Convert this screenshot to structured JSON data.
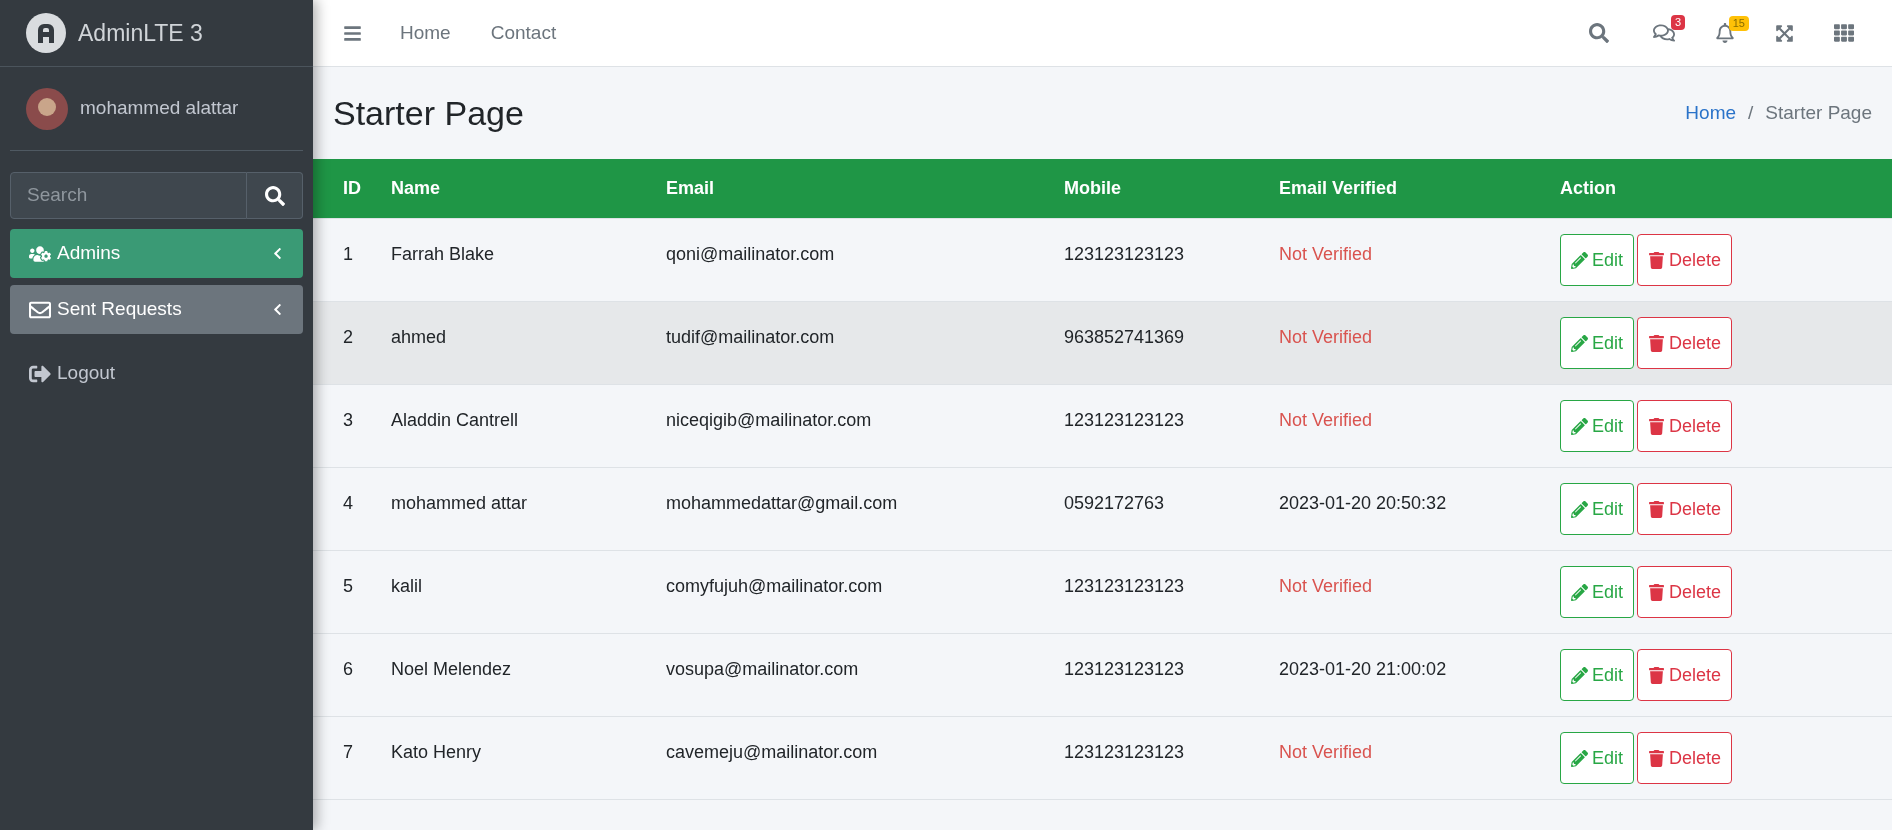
{
  "brand": {
    "title": "AdminLTE 3"
  },
  "user": {
    "name": "mohammed alattar"
  },
  "sidebar": {
    "search": {
      "placeholder": "Search"
    },
    "items": [
      {
        "label": "Admins",
        "kind": "users",
        "selected": true,
        "expandable": true
      },
      {
        "label": "Sent Requests",
        "kind": "envelope",
        "selected": false,
        "expandable": true
      },
      {
        "label": "Logout",
        "kind": "logout",
        "selected": false,
        "expandable": false
      }
    ]
  },
  "navbar": {
    "links": [
      "Home",
      "Contact"
    ],
    "messages_badge": "3",
    "notifications_badge": "15"
  },
  "page": {
    "title": "Starter Page",
    "breadcrumb_separator": "/",
    "breadcrumb": [
      {
        "label": "Home",
        "link": true
      },
      {
        "label": "Starter Page",
        "link": false
      }
    ]
  },
  "table": {
    "columns": [
      "ID",
      "Name",
      "Email",
      "Mobile",
      "Email Verified",
      "Action"
    ],
    "rows": [
      {
        "id": "1",
        "name": "Farrah Blake",
        "email": "qoni@mailinator.com",
        "mobile": "123123123123",
        "verified": "Not Verified",
        "is_verified": false,
        "highlighted": false,
        "actions": [
          "Edit",
          "Delete"
        ]
      },
      {
        "id": "2",
        "name": "ahmed",
        "email": "tudif@mailinator.com",
        "mobile": "963852741369",
        "verified": "Not Verified",
        "is_verified": false,
        "highlighted": true,
        "actions": [
          "Edit",
          "Delete"
        ]
      },
      {
        "id": "3",
        "name": "Aladdin Cantrell",
        "email": "niceqigib@mailinator.com",
        "mobile": "123123123123",
        "verified": "Not Verified",
        "is_verified": false,
        "highlighted": false,
        "actions": [
          "Edit",
          "Delete"
        ]
      },
      {
        "id": "4",
        "name": "mohammed attar",
        "email": "mohammedattar@gmail.com",
        "mobile": "0592172763",
        "verified": "2023-01-20 20:50:32",
        "is_verified": true,
        "highlighted": false,
        "actions": [
          "Edit",
          "Delete"
        ]
      },
      {
        "id": "5",
        "name": "kalil",
        "email": "comyfujuh@mailinator.com",
        "mobile": "123123123123",
        "verified": "Not Verified",
        "is_verified": false,
        "highlighted": false,
        "actions": [
          "Edit",
          "Delete"
        ]
      },
      {
        "id": "6",
        "name": "Noel Melendez",
        "email": "vosupa@mailinator.com",
        "mobile": "123123123123",
        "verified": "2023-01-20 21:00:02",
        "is_verified": true,
        "highlighted": false,
        "actions": [
          "Edit",
          "Delete"
        ]
      },
      {
        "id": "7",
        "name": "Kato Henry",
        "email": "cavemeju@mailinator.com",
        "mobile": "123123123123",
        "verified": "Not Verified",
        "is_verified": false,
        "highlighted": false,
        "actions": [
          "Edit",
          "Delete"
        ]
      }
    ]
  }
}
